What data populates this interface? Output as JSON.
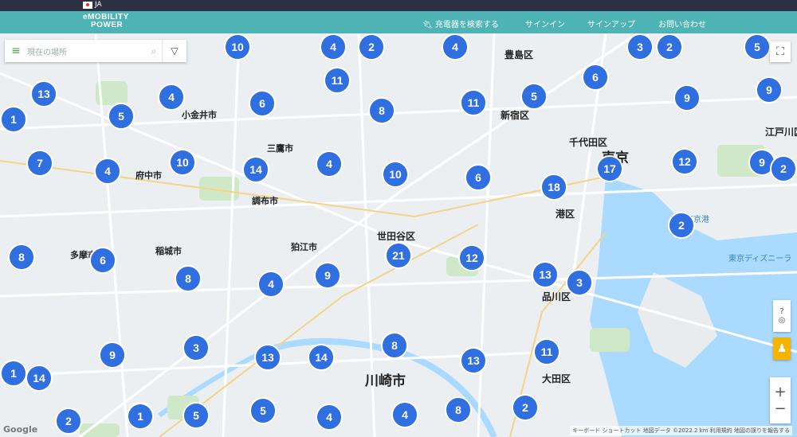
{
  "header": {
    "language": "JA",
    "logo_line1": "eMOBILITY",
    "logo_line2": "POWER",
    "nav": [
      {
        "label": "充電器を検索する",
        "icon": "plug-icon"
      },
      {
        "label": "サインイン"
      },
      {
        "label": "サインアップ"
      },
      {
        "label": "お問い合わせ"
      }
    ]
  },
  "search": {
    "placeholder": "現在の場所"
  },
  "colors": {
    "navbar": "#4eb3b5",
    "topbar": "#2b3142",
    "cluster": "#2f6fe0",
    "water": "#aadaff"
  },
  "places": [
    {
      "label": "豊島区",
      "size": "md"
    },
    {
      "label": "新宿区",
      "size": "md"
    },
    {
      "label": "千代田区",
      "size": "md"
    },
    {
      "label": "東京",
      "size": "lg"
    },
    {
      "label": "江戸川区",
      "size": "md"
    },
    {
      "label": "世田谷区",
      "size": "md"
    },
    {
      "label": "港区",
      "size": "md"
    },
    {
      "label": "品川区",
      "size": "md"
    },
    {
      "label": "大田区",
      "size": "md"
    },
    {
      "label": "川崎市",
      "size": "lg"
    },
    {
      "label": "府中市",
      "size": "sm"
    },
    {
      "label": "調布市",
      "size": "sm"
    },
    {
      "label": "狛江市",
      "size": "sm"
    },
    {
      "label": "多摩市",
      "size": "sm"
    },
    {
      "label": "稲城市",
      "size": "sm"
    },
    {
      "label": "小金井市",
      "size": "sm"
    },
    {
      "label": "三鷹市",
      "size": "sm"
    },
    {
      "label": "東京ディズニーラ",
      "size": "water"
    },
    {
      "label": "東京港",
      "size": "water"
    }
  ],
  "clusters": [
    "10",
    "2",
    "4",
    "4",
    "3",
    "2",
    "5",
    "13",
    "4",
    "6",
    "11",
    "8",
    "11",
    "5",
    "6",
    "9",
    "9",
    "1",
    "5",
    "7",
    "4",
    "10",
    "14",
    "4",
    "10",
    "6",
    "18",
    "17",
    "12",
    "9",
    "2",
    "2",
    "8",
    "6",
    "8",
    "4",
    "9",
    "21",
    "12",
    "13",
    "3",
    "1",
    "9",
    "3",
    "13",
    "14",
    "8",
    "13",
    "11",
    "1",
    "14",
    "2",
    "1",
    "5",
    "5",
    "4",
    "4",
    "8",
    "2"
  ],
  "attribution": "キーボード ショートカット  地図データ ©2022  2 km  利用規約  地図の誤りを報告する",
  "google": "Google"
}
